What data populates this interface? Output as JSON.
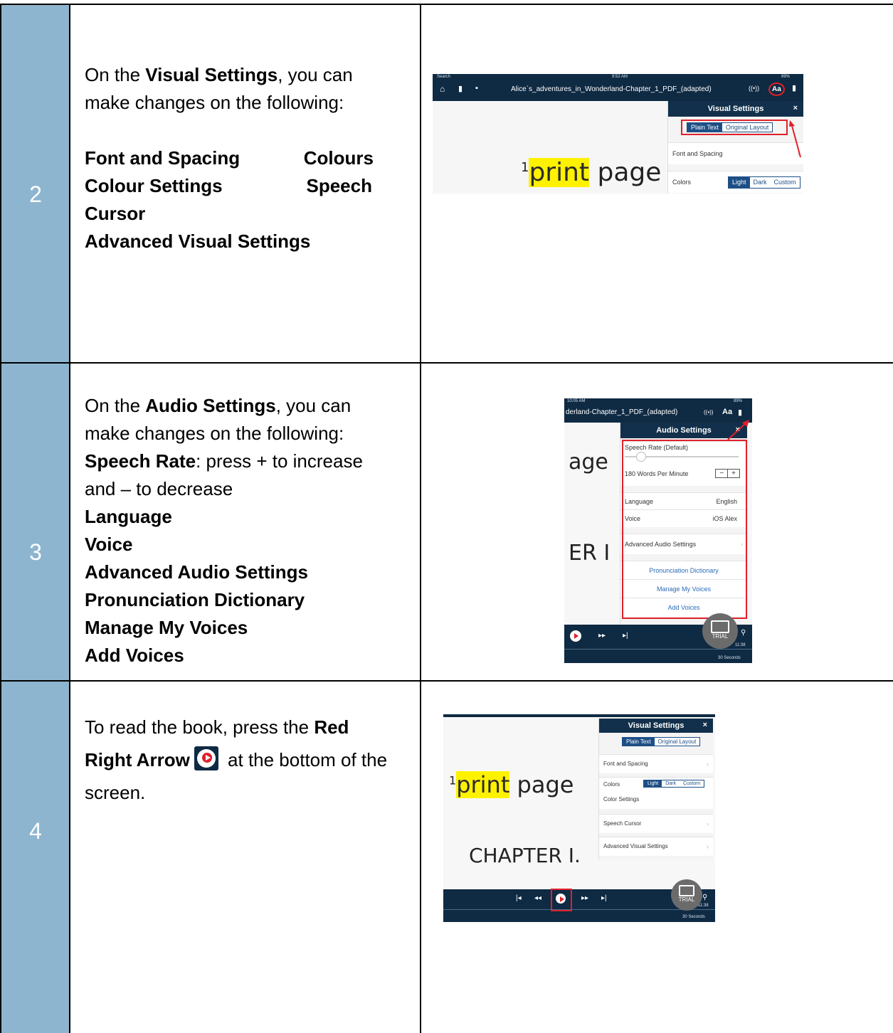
{
  "rows": [
    {
      "number": "2",
      "intro_prefix": "On the ",
      "intro_bold": "Visual Settings",
      "intro_suffix": ", you can make changes on the following:",
      "items": [
        "Font and Spacing",
        "Colours",
        "Colour Settings",
        "Speech",
        "Cursor",
        "Advanced Visual Settings"
      ],
      "screenshot": {
        "status_left": "Search",
        "status_time": "9:52 AM",
        "status_right": "89%",
        "doc_title": "Alice`s_adventures_in_Wonderland-Chapter_1_PDF_(adapted)",
        "aa_label": "Aa",
        "panel_title": "Visual Settings",
        "close": "×",
        "mode_plain": "Plain Text",
        "mode_original": "Original Layout",
        "font_spacing": "Font and Spacing",
        "colors_label": "Colors",
        "color_light": "Light",
        "color_dark": "Dark",
        "color_custom": "Custom",
        "page_sup": "1",
        "page_word1": "print",
        "page_word2": "page"
      }
    },
    {
      "number": "3",
      "intro_prefix": "On the ",
      "intro_bold": "Audio Settings",
      "intro_suffix": ", you can make changes on the following:",
      "speech_rate_bold": "Speech Rate",
      "speech_rate_text": ": press + to increase and – to decrease",
      "items": [
        "Language",
        "Voice",
        "Advanced Audio Settings",
        "Pronunciation Dictionary",
        "Manage My Voices",
        "Add Voices"
      ],
      "screenshot": {
        "status_time": "10:05 AM",
        "status_right": "89%",
        "doc_title": "derland-Chapter_1_PDF_(adapted)",
        "aa_label": "Aa",
        "panel_title": "Audio Settings",
        "close": "×",
        "rate_label": "Speech Rate (Default)",
        "rate_value": "180 Words Per Minute",
        "minus": "−",
        "plus": "+",
        "language_label": "Language",
        "language_value": "English",
        "voice_label": "Voice",
        "voice_value": "iOS Alex",
        "advanced": "Advanced Audio Settings",
        "pronunciation": "Pronunciation Dictionary",
        "manage": "Manage My Voices",
        "add": "Add Voices",
        "bg_word1": "age",
        "bg_word2": "ER I",
        "trial": "TRIAL",
        "time": "11:38",
        "seconds": "30 Seconds"
      }
    },
    {
      "number": "4",
      "text_prefix": "To read the book, press the ",
      "text_bold": "Red Right Arrow",
      "text_suffix": " at the bottom of the screen.",
      "screenshot": {
        "panel_title": "Visual Settings",
        "close": "×",
        "mode_plain": "Plain Text",
        "mode_original": "Original Layout",
        "font_spacing": "Font and Spacing",
        "colors_label": "Colors",
        "color_light": "Light",
        "color_dark": "Dark",
        "color_custom": "Custom",
        "color_settings": "Color Settings",
        "speech_cursor": "Speech Cursor",
        "advanced_visual": "Advanced Visual Settings",
        "page_sup": "1",
        "page_word1": "print",
        "page_word2": "page",
        "chapter": "CHAPTER I.",
        "trial": "TRIAL",
        "time": "11:38",
        "seconds": "30 Seconds"
      }
    }
  ]
}
